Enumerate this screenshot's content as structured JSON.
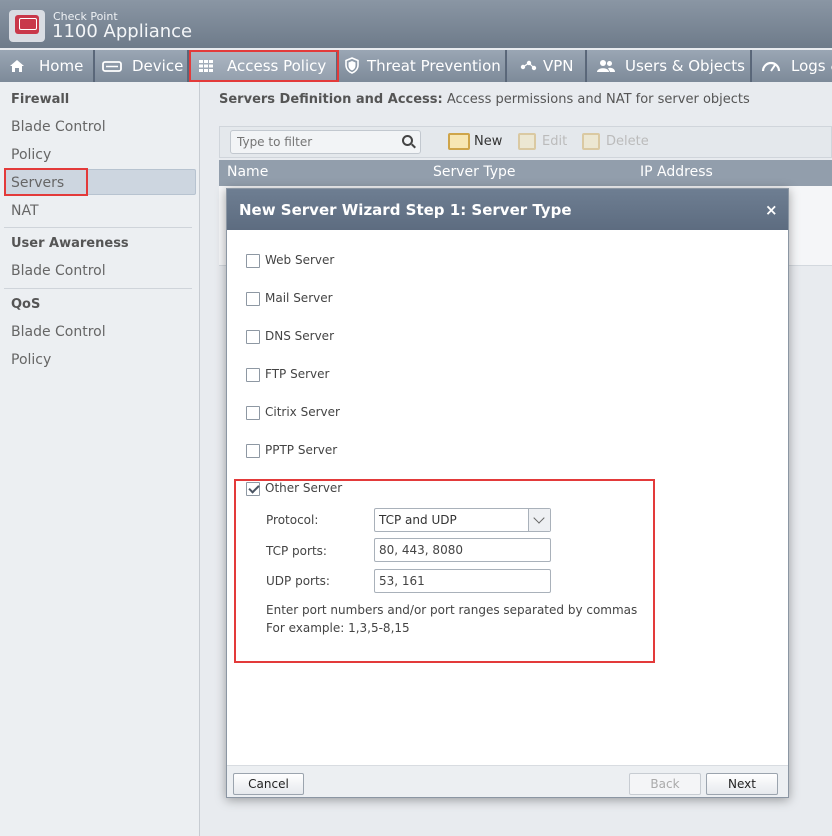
{
  "app": {
    "vendor": "Check Point",
    "title": "1100 Appliance"
  },
  "nav": {
    "tabs": [
      {
        "label": "Home",
        "icon": "home-icon"
      },
      {
        "label": "Device",
        "icon": "device-icon"
      },
      {
        "label": "Access Policy",
        "icon": "grid-icon"
      },
      {
        "label": "Threat Prevention",
        "icon": "shield-icon"
      },
      {
        "label": "VPN",
        "icon": "vpn-icon"
      },
      {
        "label": "Users & Objects",
        "icon": "users-icon"
      },
      {
        "label": "Logs &",
        "icon": "logs-icon"
      }
    ]
  },
  "sidebar": {
    "firewall_heading": "Firewall",
    "firewall_items": [
      "Blade Control",
      "Policy",
      "Servers",
      "NAT"
    ],
    "ua_heading": "User Awareness",
    "ua_items": [
      "Blade Control"
    ],
    "qos_heading": "QoS",
    "qos_items": [
      "Blade Control",
      "Policy"
    ]
  },
  "main": {
    "title_bold": "Servers Definition and Access:",
    "title_rest": " Access permissions and NAT for server objects",
    "filter_placeholder": "Type to filter",
    "toolbar": {
      "new": "New",
      "edit": "Edit",
      "delete": "Delete"
    },
    "columns": [
      "Name",
      "Server Type",
      "IP Address"
    ]
  },
  "modal": {
    "title": "New Server Wizard  Step 1: Server Type",
    "close": "×",
    "server_types": [
      {
        "label": "Web Server",
        "checked": false
      },
      {
        "label": "Mail Server",
        "checked": false
      },
      {
        "label": "DNS Server",
        "checked": false
      },
      {
        "label": "FTP Server",
        "checked": false
      },
      {
        "label": "Citrix Server",
        "checked": false
      },
      {
        "label": "PPTP Server",
        "checked": false
      },
      {
        "label": "Other Server",
        "checked": true
      }
    ],
    "protocol_label": "Protocol:",
    "protocol_value": "TCP and UDP",
    "tcp_label": "TCP ports:",
    "tcp_value": "80, 443, 8080",
    "udp_label": "UDP ports:",
    "udp_value": "53, 161",
    "hint_line1": "Enter port numbers and/or port ranges separated by commas",
    "hint_line2": "For example: 1,3,5-8,15",
    "buttons": {
      "cancel": "Cancel",
      "back": "Back",
      "next": "Next"
    }
  },
  "colors": {
    "highlight": "#e33a3a",
    "header": "#6e7b8a",
    "modal_header": "#5d6c80"
  }
}
